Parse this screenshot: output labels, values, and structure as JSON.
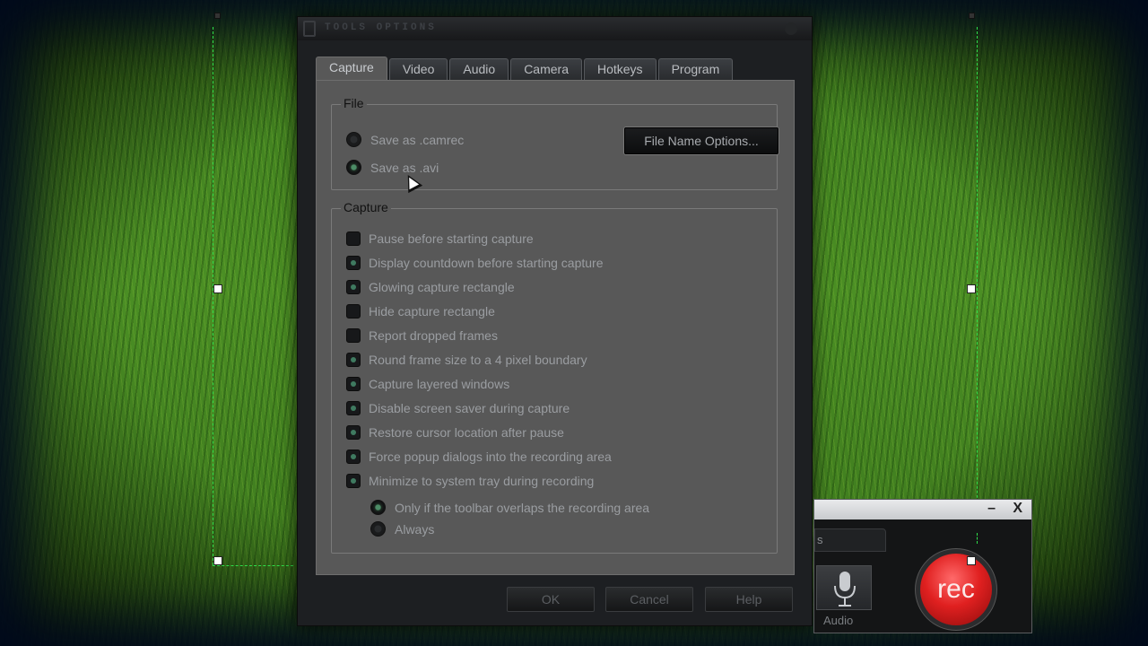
{
  "dialog": {
    "title": "TOOLS OPTIONS",
    "tabs": [
      {
        "label": "Capture",
        "active": true
      },
      {
        "label": "Video",
        "active": false
      },
      {
        "label": "Audio",
        "active": false
      },
      {
        "label": "Camera",
        "active": false
      },
      {
        "label": "Hotkeys",
        "active": false
      },
      {
        "label": "Program",
        "active": false
      }
    ],
    "file_group": {
      "title": "File",
      "options": [
        {
          "label": "Save as .camrec",
          "selected": false
        },
        {
          "label": "Save as .avi",
          "selected": true
        }
      ],
      "file_name_button": "File Name Options..."
    },
    "capture_group": {
      "title": "Capture",
      "checkboxes": [
        {
          "label": "Pause before starting capture",
          "checked": false
        },
        {
          "label": "Display countdown before starting capture",
          "checked": true
        },
        {
          "label": "Glowing capture rectangle",
          "checked": true
        },
        {
          "label": "Hide capture rectangle",
          "checked": false
        },
        {
          "label": "Report dropped frames",
          "checked": false
        },
        {
          "label": "Round frame size to a 4 pixel boundary",
          "checked": true
        },
        {
          "label": "Capture layered windows",
          "checked": true
        },
        {
          "label": "Disable screen saver during capture",
          "checked": true
        },
        {
          "label": "Restore cursor location after pause",
          "checked": true
        },
        {
          "label": "Force popup dialogs into the recording area",
          "checked": true
        },
        {
          "label": "Minimize to system tray during recording",
          "checked": true
        }
      ],
      "sub_options": [
        {
          "label": "Only if the toolbar overlaps the recording area",
          "selected": true
        },
        {
          "label": "Always",
          "selected": false
        }
      ]
    },
    "buttons": {
      "ok": "OK",
      "cancel": "Cancel",
      "help": "Help"
    }
  },
  "recorder": {
    "minimize_symbol": "–",
    "close_symbol": "X",
    "tab_label": "s",
    "audio_label": "Audio",
    "rec_label": "rec"
  },
  "colors": {
    "accent_green": "#2fe04a",
    "rec_red": "#e02020",
    "panel_gray": "#585858"
  }
}
